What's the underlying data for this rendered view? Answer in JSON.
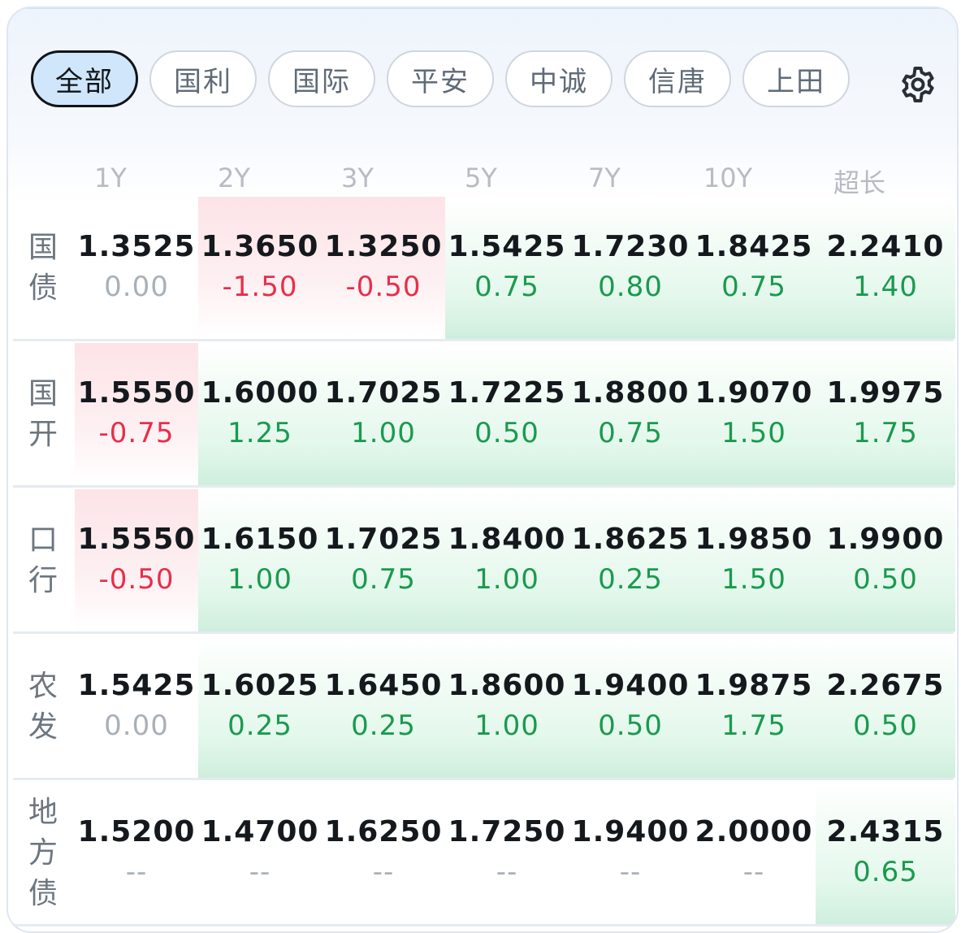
{
  "tabs": [
    {
      "label": "全部",
      "active": true
    },
    {
      "label": "国利",
      "active": false
    },
    {
      "label": "国际",
      "active": false
    },
    {
      "label": "平安",
      "active": false
    },
    {
      "label": "中诚",
      "active": false
    },
    {
      "label": "信唐",
      "active": false
    },
    {
      "label": "上田",
      "active": false
    }
  ],
  "settings_icon": "gear-icon",
  "columns": [
    "1Y",
    "2Y",
    "3Y",
    "5Y",
    "7Y",
    "10Y",
    "超长"
  ],
  "colors": {
    "up": "#1a9a4e",
    "down": "#ea2d4a",
    "flat": "#a8b0b8"
  },
  "rows": [
    {
      "label_chars": [
        "国",
        "债"
      ],
      "cells": [
        {
          "value": "1.3525",
          "change": "0.00",
          "dir": "zero"
        },
        {
          "value": "1.3650",
          "change": "-1.50",
          "dir": "neg"
        },
        {
          "value": "1.3250",
          "change": "-0.50",
          "dir": "neg"
        },
        {
          "value": "1.5425",
          "change": "0.75",
          "dir": "pos"
        },
        {
          "value": "1.7230",
          "change": "0.80",
          "dir": "pos"
        },
        {
          "value": "1.8425",
          "change": "0.75",
          "dir": "pos"
        },
        {
          "value": "2.2410",
          "change": "1.40",
          "dir": "pos"
        }
      ]
    },
    {
      "label_chars": [
        "国",
        "开"
      ],
      "cells": [
        {
          "value": "1.5550",
          "change": "-0.75",
          "dir": "neg"
        },
        {
          "value": "1.6000",
          "change": "1.25",
          "dir": "pos"
        },
        {
          "value": "1.7025",
          "change": "1.00",
          "dir": "pos"
        },
        {
          "value": "1.7225",
          "change": "0.50",
          "dir": "pos"
        },
        {
          "value": "1.8800",
          "change": "0.75",
          "dir": "pos"
        },
        {
          "value": "1.9070",
          "change": "1.50",
          "dir": "pos"
        },
        {
          "value": "1.9975",
          "change": "1.75",
          "dir": "pos"
        }
      ]
    },
    {
      "label_chars": [
        "口",
        "行"
      ],
      "cells": [
        {
          "value": "1.5550",
          "change": "-0.50",
          "dir": "neg"
        },
        {
          "value": "1.6150",
          "change": "1.00",
          "dir": "pos"
        },
        {
          "value": "1.7025",
          "change": "0.75",
          "dir": "pos"
        },
        {
          "value": "1.8400",
          "change": "1.00",
          "dir": "pos"
        },
        {
          "value": "1.8625",
          "change": "0.25",
          "dir": "pos"
        },
        {
          "value": "1.9850",
          "change": "1.50",
          "dir": "pos"
        },
        {
          "value": "1.9900",
          "change": "0.50",
          "dir": "pos"
        }
      ]
    },
    {
      "label_chars": [
        "农",
        "发"
      ],
      "cells": [
        {
          "value": "1.5425",
          "change": "0.00",
          "dir": "zero"
        },
        {
          "value": "1.6025",
          "change": "0.25",
          "dir": "pos"
        },
        {
          "value": "1.6450",
          "change": "0.25",
          "dir": "pos"
        },
        {
          "value": "1.8600",
          "change": "1.00",
          "dir": "pos"
        },
        {
          "value": "1.9400",
          "change": "0.50",
          "dir": "pos"
        },
        {
          "value": "1.9875",
          "change": "1.75",
          "dir": "pos"
        },
        {
          "value": "2.2675",
          "change": "0.50",
          "dir": "pos"
        }
      ]
    },
    {
      "label_chars": [
        "地",
        "方",
        "债"
      ],
      "cells": [
        {
          "value": "1.5200",
          "change": "--",
          "dir": "none"
        },
        {
          "value": "1.4700",
          "change": "--",
          "dir": "none"
        },
        {
          "value": "1.6250",
          "change": "--",
          "dir": "none"
        },
        {
          "value": "1.7250",
          "change": "--",
          "dir": "none"
        },
        {
          "value": "1.9400",
          "change": "--",
          "dir": "none"
        },
        {
          "value": "2.0000",
          "change": "--",
          "dir": "none"
        },
        {
          "value": "2.4315",
          "change": "0.65",
          "dir": "pos"
        }
      ]
    }
  ]
}
